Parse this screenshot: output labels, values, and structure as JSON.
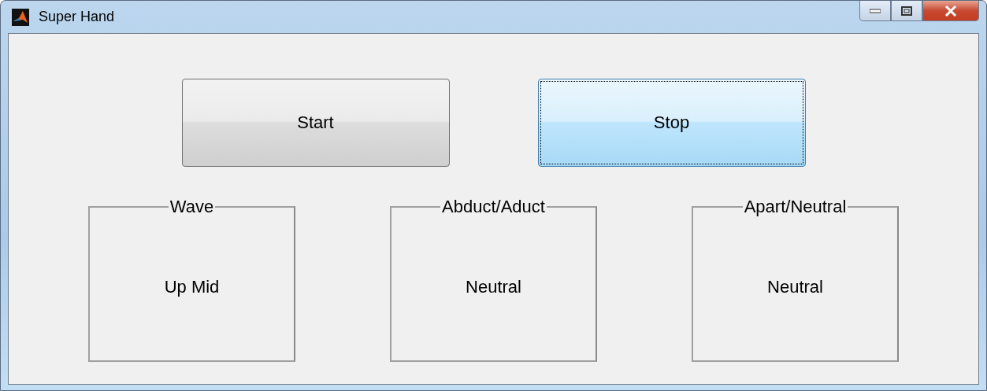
{
  "window": {
    "title": "Super Hand"
  },
  "buttons": [
    {
      "label": "Start",
      "selected": false
    },
    {
      "label": "Stop",
      "selected": true
    }
  ],
  "panels": [
    {
      "title": "Wave",
      "value": "Up Mid"
    },
    {
      "title": "Abduct/Aduct",
      "value": "Neutral"
    },
    {
      "title": "Apart/Neutral",
      "value": "Neutral"
    }
  ]
}
